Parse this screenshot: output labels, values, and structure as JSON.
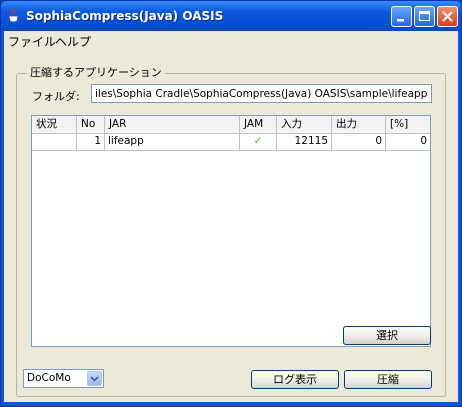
{
  "window": {
    "title": "SophiaCompress(Java) OASIS",
    "icon": "java-cup-icon",
    "controls": [
      "minimize-icon",
      "maximize-icon",
      "close-icon"
    ]
  },
  "menu": {
    "file": "ファイル",
    "help": "ヘルプ"
  },
  "group": {
    "title": "圧縮するアプリケーション",
    "folder_label": "フォルダ:",
    "folder_value": "iles\\Sophia Cradle\\SophiaCompress(Java) OASIS\\sample\\lifeapp.jar"
  },
  "table": {
    "columns": [
      "状況",
      "No",
      "JAR",
      "JAM",
      "入力",
      "出力",
      "[%]"
    ],
    "rows": [
      {
        "status": "",
        "no": "1",
        "jar": "lifeapp",
        "jam": "✓",
        "input": "12115",
        "output": "0",
        "percent": "0"
      }
    ]
  },
  "buttons": {
    "select": "選択",
    "log": "ログ表示",
    "compress": "圧縮"
  },
  "carrier": {
    "selected": "DoCoMo"
  },
  "colors": {
    "titlebar": "#0a5ae0",
    "client": "#ece9d8",
    "check": "#4caf50"
  }
}
